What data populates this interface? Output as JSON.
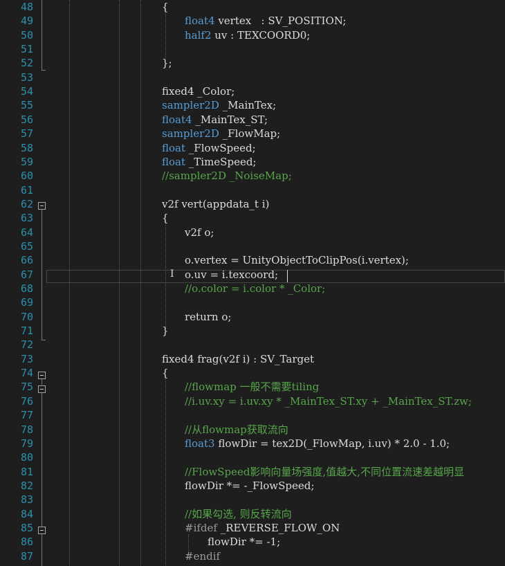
{
  "editor": {
    "language": "ShaderLab / HLSL",
    "colors": {
      "background": "#1e1e1e",
      "line_number": "#2b91af",
      "keyword": "#569cd6",
      "comment": "#57a64a",
      "text": "#dcdcdc",
      "preprocessor": "#9b9b9b"
    },
    "lines": [
      {
        "n": "48",
        "indent": 0,
        "tokens": [
          {
            "t": "{",
            "c": "txt"
          }
        ]
      },
      {
        "n": "49",
        "indent": 1,
        "tokens": [
          {
            "t": "float4",
            "c": "kw"
          },
          {
            "t": " vertex   : SV_POSITION;",
            "c": "txt"
          }
        ]
      },
      {
        "n": "50",
        "indent": 1,
        "tokens": [
          {
            "t": "half2",
            "c": "kw"
          },
          {
            "t": " uv : TEXCOORD0;",
            "c": "txt"
          }
        ]
      },
      {
        "n": "51",
        "indent": 0,
        "tokens": []
      },
      {
        "n": "52",
        "indent": 0,
        "tokens": [
          {
            "t": "};",
            "c": "txt"
          }
        ]
      },
      {
        "n": "53",
        "indent": 0,
        "tokens": []
      },
      {
        "n": "54",
        "indent": 0,
        "tokens": [
          {
            "t": "fixed4 _Color;",
            "c": "txt"
          }
        ]
      },
      {
        "n": "55",
        "indent": 0,
        "tokens": [
          {
            "t": "sampler2D",
            "c": "kw"
          },
          {
            "t": " _MainTex;",
            "c": "txt"
          }
        ]
      },
      {
        "n": "56",
        "indent": 0,
        "tokens": [
          {
            "t": "float4",
            "c": "kw"
          },
          {
            "t": " _MainTex_ST;",
            "c": "txt"
          }
        ]
      },
      {
        "n": "57",
        "indent": 0,
        "tokens": [
          {
            "t": "sampler2D",
            "c": "kw"
          },
          {
            "t": " _FlowMap;",
            "c": "txt"
          }
        ]
      },
      {
        "n": "58",
        "indent": 0,
        "tokens": [
          {
            "t": "float",
            "c": "kw"
          },
          {
            "t": " _FlowSpeed;",
            "c": "txt"
          }
        ]
      },
      {
        "n": "59",
        "indent": 0,
        "tokens": [
          {
            "t": "float",
            "c": "kw"
          },
          {
            "t": " _TimeSpeed;",
            "c": "txt"
          }
        ]
      },
      {
        "n": "60",
        "indent": 0,
        "tokens": [
          {
            "t": "//sampler2D _NoiseMap;",
            "c": "cm"
          }
        ]
      },
      {
        "n": "61",
        "indent": 0,
        "tokens": []
      },
      {
        "n": "62",
        "indent": 0,
        "tokens": [
          {
            "t": "v2f vert(appdata_t i)",
            "c": "txt"
          }
        ]
      },
      {
        "n": "63",
        "indent": 0,
        "tokens": [
          {
            "t": "{",
            "c": "txt"
          }
        ]
      },
      {
        "n": "64",
        "indent": 1,
        "tokens": [
          {
            "t": "v2f o;",
            "c": "txt"
          }
        ]
      },
      {
        "n": "65",
        "indent": 0,
        "tokens": []
      },
      {
        "n": "66",
        "indent": 1,
        "tokens": [
          {
            "t": "o.vertex = UnityObjectToClipPos(i.vertex);",
            "c": "txt"
          }
        ]
      },
      {
        "n": "67",
        "indent": 1,
        "tokens": [
          {
            "t": "o.uv = i.texcoord;",
            "c": "txt"
          }
        ]
      },
      {
        "n": "68",
        "indent": 1,
        "tokens": [
          {
            "t": "//o.color = i.color * _Color;",
            "c": "cm"
          }
        ]
      },
      {
        "n": "69",
        "indent": 0,
        "tokens": []
      },
      {
        "n": "70",
        "indent": 1,
        "tokens": [
          {
            "t": "return o;",
            "c": "txt"
          }
        ]
      },
      {
        "n": "71",
        "indent": 0,
        "tokens": [
          {
            "t": "}",
            "c": "txt"
          }
        ]
      },
      {
        "n": "72",
        "indent": 0,
        "tokens": []
      },
      {
        "n": "73",
        "indent": 0,
        "tokens": [
          {
            "t": "fixed4 frag(v2f i) : SV_Target",
            "c": "txt"
          }
        ]
      },
      {
        "n": "74",
        "indent": 0,
        "tokens": [
          {
            "t": "{",
            "c": "txt"
          }
        ]
      },
      {
        "n": "75",
        "indent": 1,
        "tokens": [
          {
            "t": "//flowmap 一般不需要tiling",
            "c": "cm"
          }
        ]
      },
      {
        "n": "76",
        "indent": 1,
        "tokens": [
          {
            "t": "//i.uv.xy = i.uv.xy * _MainTex_ST.xy + _MainTex_ST.zw;",
            "c": "cm"
          }
        ]
      },
      {
        "n": "77",
        "indent": 0,
        "tokens": []
      },
      {
        "n": "78",
        "indent": 1,
        "tokens": [
          {
            "t": "//从flowmap获取流向",
            "c": "cm"
          }
        ]
      },
      {
        "n": "79",
        "indent": 1,
        "tokens": [
          {
            "t": "float3",
            "c": "kw"
          },
          {
            "t": " flowDir = tex2D(_FlowMap, i.uv) * 2.0 - 1.0;",
            "c": "txt"
          }
        ]
      },
      {
        "n": "80",
        "indent": 0,
        "tokens": []
      },
      {
        "n": "81",
        "indent": 1,
        "tokens": [
          {
            "t": "//FlowSpeed影响向量场强度,值越大,不同位置流速差越明显",
            "c": "cm"
          }
        ]
      },
      {
        "n": "82",
        "indent": 1,
        "tokens": [
          {
            "t": "flowDir *= -_FlowSpeed;",
            "c": "txt"
          }
        ]
      },
      {
        "n": "83",
        "indent": 0,
        "tokens": []
      },
      {
        "n": "84",
        "indent": 1,
        "tokens": [
          {
            "t": "//如果勾选, 则反转流向",
            "c": "cm"
          }
        ]
      },
      {
        "n": "85",
        "indent": 1,
        "tokens": [
          {
            "t": "#ifdef",
            "c": "pp"
          },
          {
            "t": " _REVERSE_FLOW_ON",
            "c": "txt"
          }
        ]
      },
      {
        "n": "86",
        "indent": 2,
        "tokens": [
          {
            "t": "flowDir *= -1;",
            "c": "txt"
          }
        ]
      },
      {
        "n": "87",
        "indent": 1,
        "tokens": [
          {
            "t": "#endif",
            "c": "pp"
          }
        ]
      }
    ]
  }
}
